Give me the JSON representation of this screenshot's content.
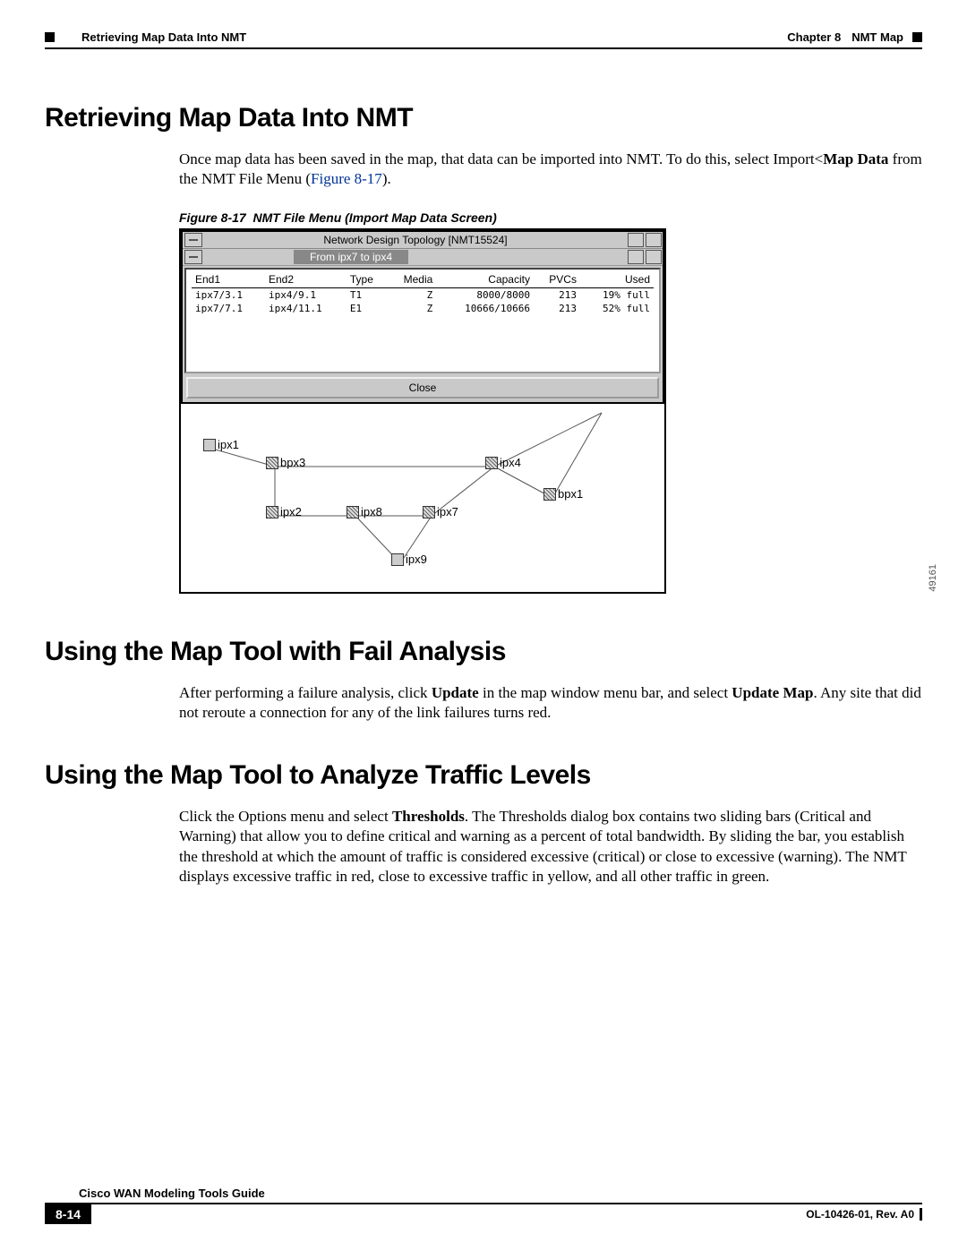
{
  "header": {
    "chapter_label": "Chapter 8",
    "chapter_title": "NMT Map",
    "section_title": "Retrieving Map Data Into NMT"
  },
  "sections": {
    "s1": {
      "heading": "Retrieving Map Data Into NMT",
      "p1_a": "Once map data has been saved in the map, that data can be imported into NMT. To do this, select Import<",
      "p1_bold": "Map Data",
      "p1_b": " from the NMT File Menu (",
      "p1_figref": "Figure 8-17",
      "p1_c": ")."
    },
    "figure": {
      "caption_num": "Figure 8-17",
      "caption_text": "NMT File Menu (Import Map Data Screen)",
      "window_title": "Network Design Topology [NMT15524]",
      "subheader": "From ipx7 to ipx4",
      "columns": [
        "End1",
        "End2",
        "Type",
        "Media",
        "Capacity",
        "PVCs",
        "Used"
      ],
      "rows": [
        {
          "end1": "ipx7/3.1",
          "end2": "ipx4/9.1",
          "type": "T1",
          "media": "Z",
          "capacity": "8000/8000",
          "pvcs": "213",
          "used": "19% full"
        },
        {
          "end1": "ipx7/7.1",
          "end2": "ipx4/11.1",
          "type": "E1",
          "media": "Z",
          "capacity": "10666/10666",
          "pvcs": "213",
          "used": "52% full"
        }
      ],
      "close_label": "Close",
      "nodes": {
        "ipx1": "ipx1",
        "bpx3": "bpx3",
        "ipx4": "ipx4",
        "bpx1": "bpx1",
        "ipx2": "ipx2",
        "ipx8": "ipx8",
        "ipx7": "ipx7",
        "ipx9": "ipx9"
      },
      "fignum_side": "49161"
    },
    "s2": {
      "heading": "Using the Map Tool with Fail Analysis",
      "p_a": "After performing a failure analysis, click ",
      "p_b1": "Update",
      "p_c": " in the map window menu bar, and select ",
      "p_b2": "Update Map",
      "p_d": ". Any site that did not reroute a connection for any of the link failures turns red."
    },
    "s3": {
      "heading": "Using the Map Tool to Analyze Traffic Levels",
      "p_a": "Click the Options menu and select ",
      "p_b1": "Thresholds",
      "p_b": ". The Thresholds dialog box contains two sliding bars (Critical and Warning) that allow you to define critical and warning as a percent of total bandwidth. By sliding the bar, you establish the threshold at which the amount of traffic is considered excessive (critical) or close to excessive (warning). The NMT displays excessive traffic in red, close to excessive traffic in yellow, and all other traffic in green."
    }
  },
  "footer": {
    "guide": "Cisco WAN Modeling Tools Guide",
    "page": "8-14",
    "doc": "OL-10426-01, Rev. A0"
  }
}
